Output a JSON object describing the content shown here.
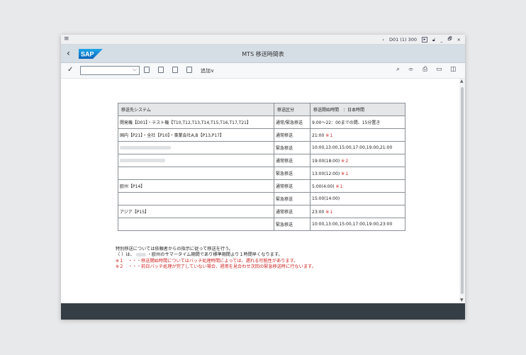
{
  "titlebar": {
    "menu_icon": "hamburger-icon",
    "system": "D01 (1) 300",
    "minimize": "_",
    "maximize": "🗗",
    "close": "×"
  },
  "shellbar": {
    "back": "‹",
    "logo": "SAP",
    "title": "MTS 移送時間表"
  },
  "toolbar": {
    "check": "✓",
    "command_value": "",
    "more_label": "追加∨"
  },
  "table": {
    "headers": [
      "移送先システム",
      "移送区分",
      "移送開始時間　：日本時間"
    ],
    "rows": [
      {
        "system": "開発機【D01】・テスト機【T10,T12,T13,T14,T15,T16,T17,T21】",
        "category": "通常/緊急移送",
        "time": "9:00～22：00までの間、15分置き",
        "mark": ""
      },
      {
        "system": "国内【P21】・全社【P10】・事業会社A,B【P13,P17】",
        "category": "通常移送",
        "time": "21:00 ",
        "mark": "※１"
      },
      {
        "system": "",
        "category": "緊急移送",
        "time": "10:00,13:00,15:00,17:00,19:00,21:00",
        "mark": ""
      },
      {
        "system": "",
        "category": "通常移送",
        "time": "19:00(18:00) ",
        "mark": "※２"
      },
      {
        "system": "",
        "category": "緊急移送",
        "time": "13:00(12:00) ",
        "mark": "※１"
      },
      {
        "system": "欧州【P14】",
        "category": "通常移送",
        "time": "5:00(4:00) ",
        "mark": "※１"
      },
      {
        "system": "",
        "category": "緊急移送",
        "time": "15:00(14:00)",
        "mark": ""
      },
      {
        "system": "アジア【P15】",
        "category": "通常移送",
        "time": "23:00 ",
        "mark": "※１"
      },
      {
        "system": "",
        "category": "緊急移送",
        "time": "10:00,13:00,15:00,17:00,19:00,23:00",
        "mark": ""
      }
    ]
  },
  "notes": {
    "line1": "特別移送については依頼者からの指示に従って移送を行う。",
    "line2a": "（ ）は、",
    "line2b": "・欧州のサマータイム期間であり標準期間より１時間早くなります。",
    "line3": "※１　・・・移送開始時間についてはバッチ処理時間によっては、遅れる可能性があります。",
    "line4": "※２　・・・前日バッチ処理が完了していない場合、週用を見合わせ次回の緊急移送時に行ないます。"
  }
}
